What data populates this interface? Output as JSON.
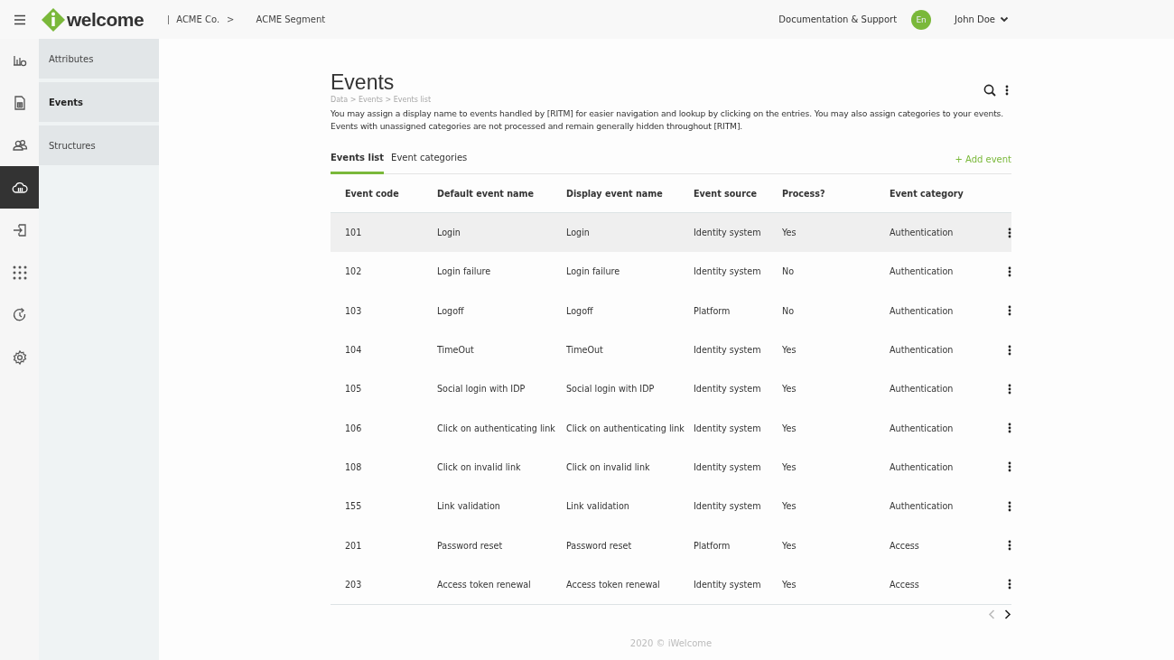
{
  "header": {
    "logo_text": "welcome",
    "breadcrumb": [
      {
        "label": "ACME Co.",
        "separator": ">"
      },
      {
        "label": "ACME Segment"
      }
    ],
    "support_link": "Documentation & Support",
    "language": "En",
    "user": "John Doe"
  },
  "rail": [
    {
      "selected": false
    },
    {
      "selected": false
    },
    {
      "selected": false
    },
    {
      "selected": true
    },
    {
      "selected": false
    },
    {
      "selected": false
    },
    {
      "selected": false
    },
    {
      "selected": false
    }
  ],
  "sidebar": {
    "items": [
      {
        "label": "Attributes",
        "selected": false
      },
      {
        "label": "Events",
        "selected": true
      },
      {
        "label": "Structures",
        "selected": false
      }
    ]
  },
  "page": {
    "title": "Events",
    "breadcrumb": "Data > Events > Events list",
    "description": "You may assign a display name to events handled by [RITM] for easier navigation and lookup by clicking on the entries. You may also assign categories to your events. Events with unassigned categories are not processed and remain generally hidden throughout [RITM]."
  },
  "tabs": [
    {
      "label": "Events list",
      "selected": true
    },
    {
      "label": "Event categories",
      "selected": false
    }
  ],
  "add_button": "+ Add event",
  "table": {
    "columns": [
      "Event code",
      "Default event name",
      "Display event name",
      "Event source",
      "Process?",
      "Event category"
    ],
    "rows": [
      {
        "cells": [
          "101",
          "Login",
          "Login",
          "Identity system",
          "Yes",
          "Authentication"
        ],
        "selected": true
      },
      {
        "cells": [
          "102",
          "Login failure",
          "Login failure",
          "Identity system",
          "No",
          "Authentication"
        ],
        "selected": false
      },
      {
        "cells": [
          "103",
          "Logoff",
          "Logoff",
          "Platform",
          "No",
          "Authentication"
        ],
        "selected": false
      },
      {
        "cells": [
          "104",
          "TimeOut",
          "TimeOut",
          "Identity system",
          "Yes",
          "Authentication"
        ],
        "selected": false
      },
      {
        "cells": [
          "105",
          "Social login with IDP",
          "Social login with IDP",
          "Identity system",
          "Yes",
          "Authentication"
        ],
        "selected": false
      },
      {
        "cells": [
          "106",
          "Click on authenticating link",
          "Click on authenticating link",
          "Identity system",
          "Yes",
          "Authentication"
        ],
        "selected": false
      },
      {
        "cells": [
          "108",
          "Click on invalid link",
          "Click on invalid link",
          "Identity system",
          "Yes",
          "Authentication"
        ],
        "selected": false
      },
      {
        "cells": [
          "155",
          "Link validation",
          "Link validation",
          "Identity system",
          "Yes",
          "Authentication"
        ],
        "selected": false
      },
      {
        "cells": [
          "201",
          "Password reset",
          "Password reset",
          "Platform",
          "Yes",
          "Access"
        ],
        "selected": false
      },
      {
        "cells": [
          "203",
          "Access token renewal",
          "Access token renewal",
          "Identity system",
          "Yes",
          "Access"
        ],
        "selected": false
      }
    ]
  },
  "pagination": {
    "prev_disabled": true,
    "next_disabled": false
  },
  "footer": "2020 © iWelcome"
}
